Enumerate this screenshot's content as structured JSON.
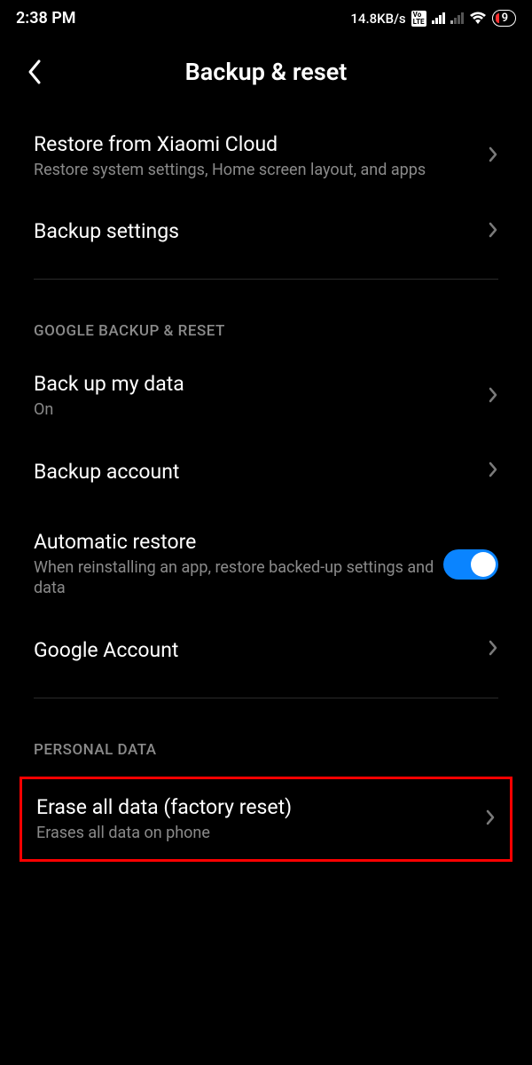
{
  "status": {
    "time": "2:38 PM",
    "netspeed": "14.8KB/s",
    "battery": "9"
  },
  "header": {
    "title": "Backup & reset"
  },
  "rows": {
    "restore_cloud": {
      "label": "Restore from Xiaomi Cloud",
      "sub": "Restore system settings, Home screen layout, and apps"
    },
    "backup_settings": {
      "label": "Backup settings"
    }
  },
  "sections": {
    "google": "GOOGLE BACKUP & RESET",
    "personal": "PERSONAL DATA"
  },
  "google_rows": {
    "backup_data": {
      "label": "Back up my data",
      "sub": "On"
    },
    "backup_account": {
      "label": "Backup account"
    },
    "auto_restore": {
      "label": "Automatic restore",
      "sub": "When reinstalling an app, restore backed-up settings and data"
    },
    "google_account": {
      "label": "Google Account"
    }
  },
  "personal_rows": {
    "erase": {
      "label": "Erase all data (factory reset)",
      "sub": "Erases all data on phone"
    }
  }
}
